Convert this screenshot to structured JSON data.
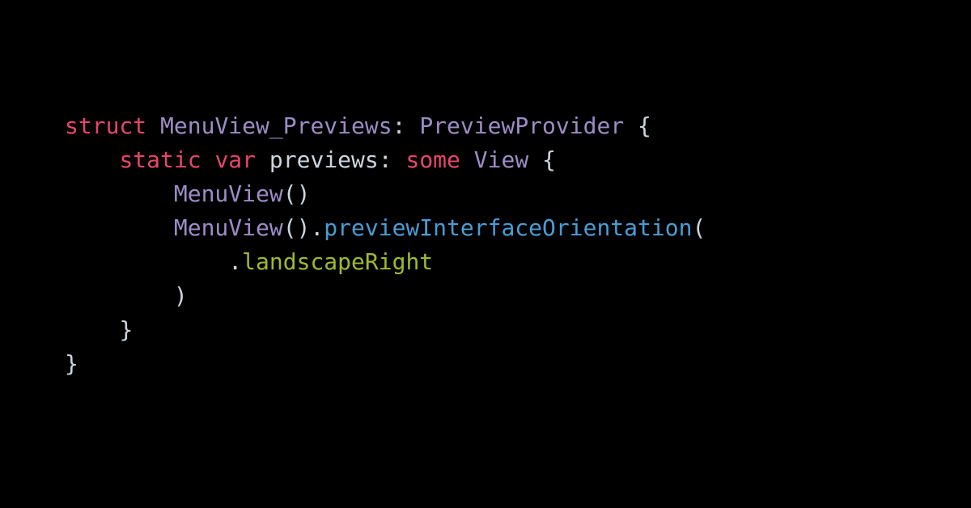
{
  "code": {
    "line1": {
      "kw_struct": "struct",
      "typename": "MenuView_Previews",
      "colon": ":",
      "protocol": "PreviewProvider",
      "brace_open": "{"
    },
    "line2": {
      "kw_static": "static",
      "kw_var": "var",
      "propname": "previews",
      "colon": ":",
      "kw_some": "some",
      "viewtype": "View",
      "brace_open": "{"
    },
    "line3": {
      "call_type": "MenuView",
      "parens": "()"
    },
    "line4": {
      "call_type": "MenuView",
      "parens_dot": "().",
      "method": "previewInterfaceOrientation",
      "paren_open": "("
    },
    "line5": {
      "dot": ".",
      "enumcase": "landscapeRight"
    },
    "line6": {
      "paren_close": ")"
    },
    "line7": {
      "brace_close": "}"
    },
    "line8": {
      "brace_close": "}"
    }
  }
}
